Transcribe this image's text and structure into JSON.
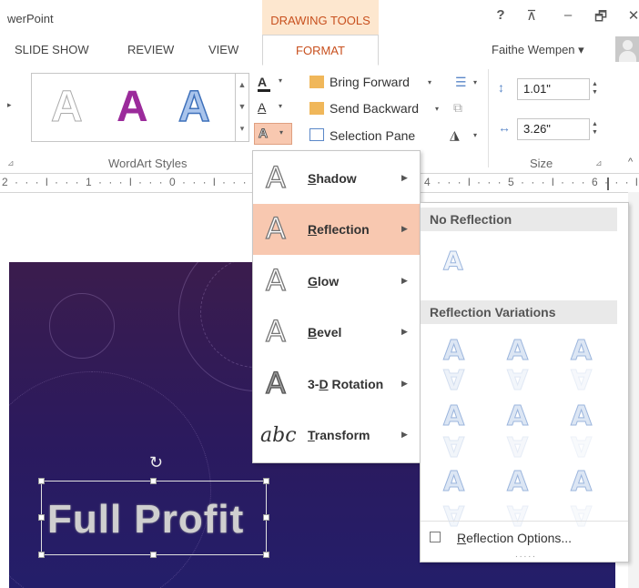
{
  "titlebar": {
    "app_title": "werPoint",
    "contextual_tab": "DRAWING TOOLS",
    "help": "?",
    "ribbon_display": "⊼",
    "minimize": "–",
    "restore": "🗗",
    "close": "✕"
  },
  "tabs": {
    "slide_show": "SLIDE SHOW",
    "review": "REVIEW",
    "view": "VIEW",
    "format": "FORMAT"
  },
  "user": {
    "name": "Faithe Wempen ▾"
  },
  "ribbon": {
    "wordart_styles_label": "WordArt Styles",
    "wordart_samples": [
      "A",
      "A",
      "A"
    ],
    "wordart_colors": [
      "#ffffff",
      "#9b2b9b",
      "#5a8fd6"
    ],
    "text_fill_icon": "A",
    "text_outline_icon": "A",
    "text_effects_icon": "A",
    "bring_forward": "Bring Forward",
    "send_backward": "Send Backward",
    "selection_pane": "Selection Pane",
    "height_value": "1.01\"",
    "width_value": "3.26\"",
    "size_label": "Size"
  },
  "ruler": {
    "left_text": "2 · · · l · · · 1 · · · l · · · 0 · · · l · · · 1 · · ·",
    "right_text": "4 · · · l · · · 5 · · · l · · · 6 · · · l"
  },
  "slide": {
    "text": "Full Profit",
    "rotate_glyph": "↻"
  },
  "menu": {
    "items": [
      {
        "icon": "A",
        "label_ul": "S",
        "label_rest": "hadow",
        "prefix": ""
      },
      {
        "icon": "A",
        "label_ul": "R",
        "label_rest": "eflection",
        "prefix": ""
      },
      {
        "icon": "A",
        "label_ul": "G",
        "label_rest": "low",
        "prefix": ""
      },
      {
        "icon": "A",
        "label_ul": "B",
        "label_rest": "evel",
        "prefix": ""
      },
      {
        "icon": "A",
        "label_ul": "D",
        "label_rest": " Rotation",
        "prefix": "3-"
      },
      {
        "icon": "abc",
        "label_ul": "T",
        "label_rest": "ransform",
        "prefix": ""
      }
    ],
    "arrow": "▶"
  },
  "submenu": {
    "no_reflection_header": "No Reflection",
    "variations_header": "Reflection Variations",
    "sample_glyph": "A",
    "options_ul": "R",
    "options_rest": "eflection Options...",
    "grip": "....."
  }
}
